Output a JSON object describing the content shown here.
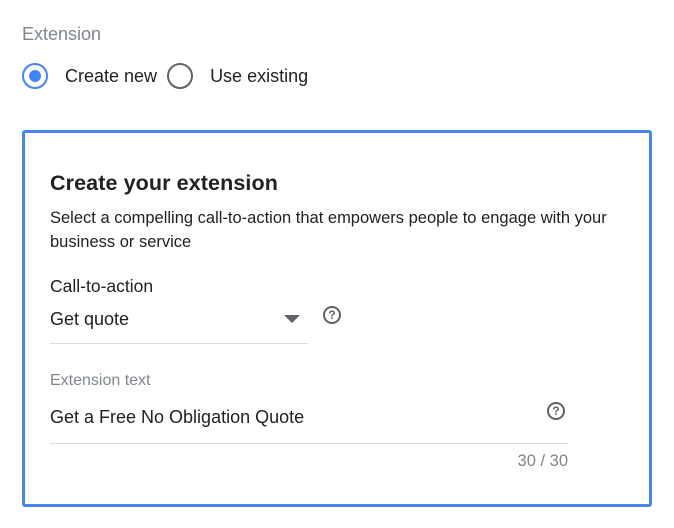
{
  "extension": {
    "section_label": "Extension",
    "options": [
      {
        "label": "Create new",
        "selected": true
      },
      {
        "label": "Use existing",
        "selected": false
      }
    ]
  },
  "card": {
    "title": "Create your extension",
    "description": "Select a compelling call-to-action that empowers people to engage with your business or service",
    "cta": {
      "label": "Call-to-action",
      "value": "Get quote",
      "help_glyph": "?"
    },
    "extension_text": {
      "label": "Extension text",
      "value": "Get a Free No Obligation Quote",
      "help_glyph": "?",
      "counter": "30 / 30"
    }
  },
  "colors": {
    "accent": "#4285f4",
    "card_border": "#4a86e8",
    "muted_text": "#80868b",
    "primary_text": "#202124",
    "divider": "#dadce0"
  },
  "icons": {
    "cta_help": "help-circle-icon",
    "extension_text_help": "help-circle-icon",
    "dropdown": "dropdown-arrow-icon"
  }
}
